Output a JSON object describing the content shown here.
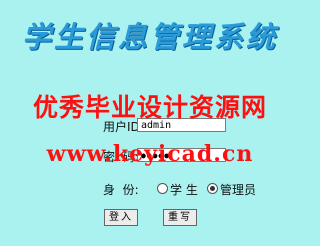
{
  "title": "学生信息管理系统",
  "watermark": {
    "line1": "优秀毕业设计资源网",
    "line2": "www.keyicad.cn"
  },
  "login": {
    "user_label": "用户ID:",
    "user_value": "admin",
    "password_label": "密  码:",
    "password_value": "●●●●●",
    "role_label": "身  份:",
    "role_options": [
      {
        "label": "学 生",
        "checked": false
      },
      {
        "label": "管理员",
        "checked": true
      }
    ],
    "submit_label": "登入",
    "reset_label": "重写"
  }
}
